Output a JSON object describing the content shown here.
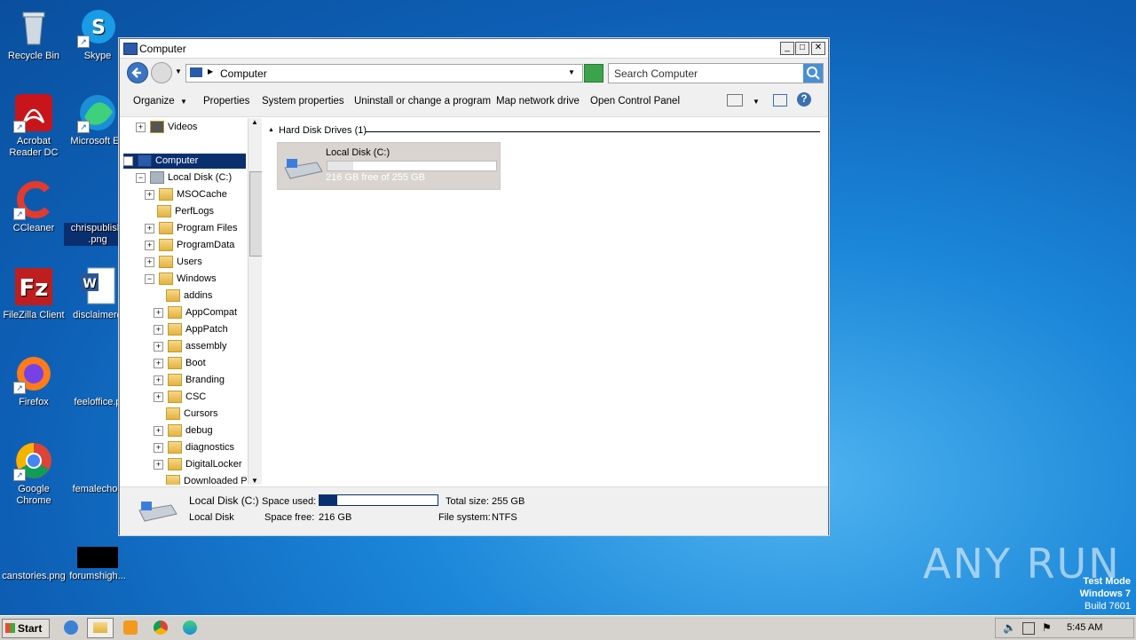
{
  "desktop": {
    "icons": [
      {
        "label": "Recycle Bin"
      },
      {
        "label": "Skype"
      },
      {
        "label": "Acrobat Reader DC"
      },
      {
        "label": "Microsoft Ed"
      },
      {
        "label": "CCleaner"
      },
      {
        "label": "chrispublishi .png"
      },
      {
        "label": "FileZilla Client"
      },
      {
        "label": "disclaimerq"
      },
      {
        "label": "Firefox"
      },
      {
        "label": "feeloffice.p"
      },
      {
        "label": "Google Chrome"
      },
      {
        "label": "femalechoo"
      },
      {
        "label": "canstories.png"
      },
      {
        "label": "forumshigh..."
      }
    ]
  },
  "window": {
    "title": "Computer",
    "address": "Computer",
    "search_placeholder": "Search Computer",
    "toolbar": {
      "organize": "Organize",
      "properties": "Properties",
      "system_properties": "System properties",
      "uninstall": "Uninstall or change a program",
      "map_drive": "Map network drive",
      "control_panel": "Open Control Panel"
    },
    "tree": [
      {
        "label": "Videos"
      },
      {
        "label": "Computer"
      },
      {
        "label": "Local Disk (C:)"
      },
      {
        "label": "MSOCache"
      },
      {
        "label": "PerfLogs"
      },
      {
        "label": "Program Files"
      },
      {
        "label": "ProgramData"
      },
      {
        "label": "Users"
      },
      {
        "label": "Windows"
      },
      {
        "label": "addins"
      },
      {
        "label": "AppCompat"
      },
      {
        "label": "AppPatch"
      },
      {
        "label": "assembly"
      },
      {
        "label": "Boot"
      },
      {
        "label": "Branding"
      },
      {
        "label": "CSC"
      },
      {
        "label": "Cursors"
      },
      {
        "label": "debug"
      },
      {
        "label": "diagnostics"
      },
      {
        "label": "DigitalLocker"
      },
      {
        "label": "Downloaded Pr"
      }
    ],
    "group_header": "Hard Disk Drives (1)",
    "drive": {
      "name": "Local Disk (C:)",
      "free_text": "216 GB free of 255 GB",
      "used_fraction": 0.15
    },
    "details": {
      "name": "Local Disk (C:)",
      "type": "Local Disk",
      "space_used_label": "Space used:",
      "space_free_label": "Space free:",
      "space_free_value": "216 GB",
      "total_size_label": "Total size:",
      "total_size_value": "255 GB",
      "fs_label": "File system:",
      "fs_value": "NTFS"
    }
  },
  "watermark": {
    "brand": "ANY RUN",
    "line1": "Test Mode",
    "line2": "Windows 7",
    "line3": "Build 7601"
  },
  "taskbar": {
    "start_label": "Start",
    "clock": "5:45 AM"
  }
}
